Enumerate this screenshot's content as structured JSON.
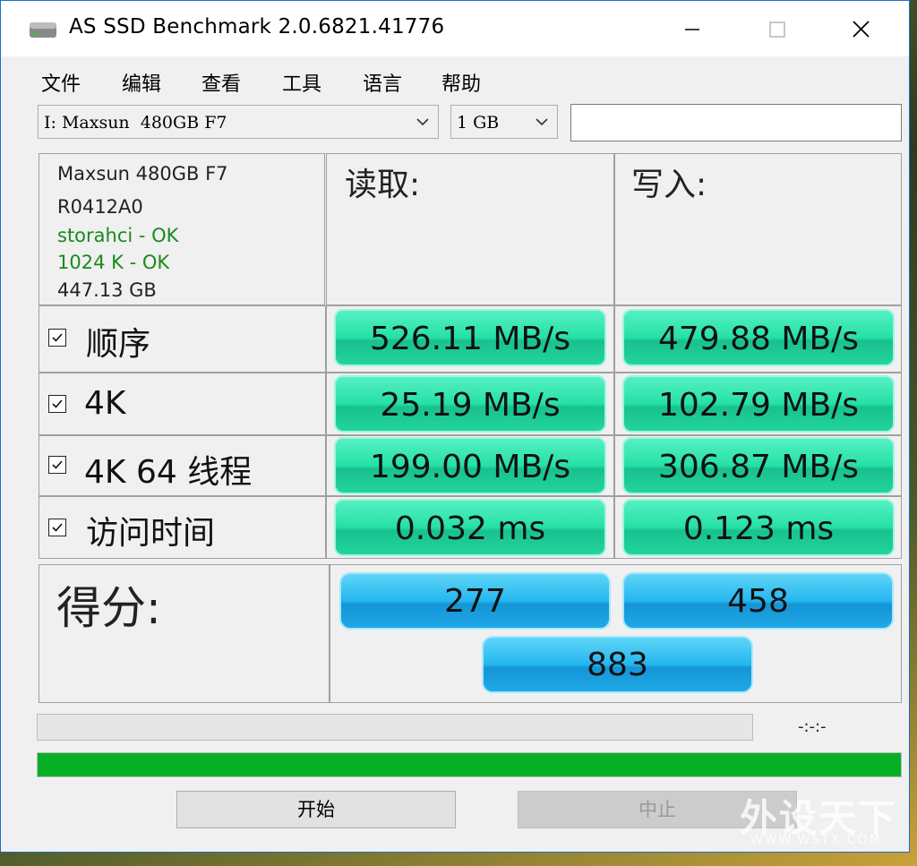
{
  "window": {
    "title": "AS SSD Benchmark 2.0.6821.41776",
    "controls": [
      "minimize-icon",
      "maximize-icon",
      "close-icon"
    ]
  },
  "menu": [
    "文件",
    "编辑",
    "查看",
    "工具",
    "语言",
    "帮助"
  ],
  "toolbar": {
    "drive_select": "I: Maxsun  480GB F7",
    "size_select": "1 GB",
    "text_field": ""
  },
  "drive_info": {
    "model": "Maxsun  480GB F7",
    "firmware": "R0412A0",
    "driver_status": "storahci - OK",
    "alignment_status": "1024 K - OK",
    "capacity": "447.13 GB",
    "ok_color": "#1a8a1a"
  },
  "headers": {
    "read": "读取:",
    "write": "写入:"
  },
  "tests": [
    {
      "label": "顺序",
      "checked": true,
      "read": "526.11 MB/s",
      "write": "479.88 MB/s"
    },
    {
      "label": "4K",
      "checked": true,
      "read": "25.19 MB/s",
      "write": "102.79 MB/s"
    },
    {
      "label": "4K 64 线程",
      "checked": true,
      "read": "199.00 MB/s",
      "write": "306.87 MB/s"
    },
    {
      "label": "访问时间",
      "checked": true,
      "read": "0.032 ms",
      "write": "0.123 ms"
    }
  ],
  "score": {
    "label": "得分:",
    "read": "277",
    "write": "458",
    "total": "883"
  },
  "status": {
    "timer": "-:-:-",
    "progress_fraction": 1.0,
    "progress_color": "#06b025"
  },
  "buttons": {
    "start": "开始",
    "stop": "中止"
  },
  "watermark": {
    "main": "外设天下",
    "site": "WWW.WSTX.COM"
  },
  "colors": {
    "result_green": "#26e0a6",
    "score_blue": "#25b6ef",
    "title_border": "#1e6fc4"
  }
}
